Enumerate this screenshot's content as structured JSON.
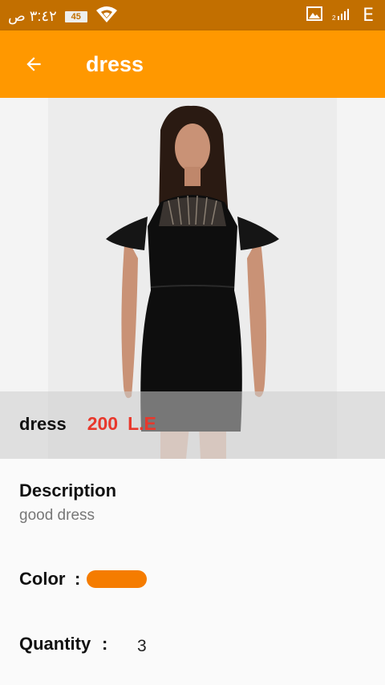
{
  "status_bar": {
    "time": "٣:٤٢ ص",
    "battery": "45",
    "network_type": "E",
    "icons": [
      "battery-icon",
      "wifi-icon",
      "gallery-notification-icon",
      "signal-icon"
    ]
  },
  "app_bar": {
    "title": "dress",
    "back_icon": "arrow-back-icon",
    "background": "#ff9800"
  },
  "product": {
    "name": "dress",
    "price": "200",
    "currency": "L.E",
    "price_color": "#e8382c"
  },
  "details": {
    "description_label": "Description",
    "description_value": "good dress",
    "color_label": "Color",
    "color_colon": ":",
    "color_value": "#f57c00",
    "quantity_label": "Quantity",
    "quantity_colon": ":",
    "quantity_value": "3"
  }
}
